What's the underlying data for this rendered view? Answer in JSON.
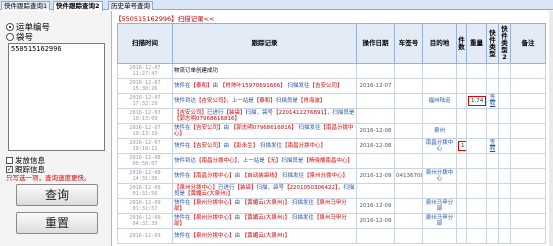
{
  "tabs": [
    {
      "label": "快件跟踪查询1"
    },
    {
      "label": "快件跟踪查询2"
    },
    {
      "label": "历史单号查询"
    }
  ],
  "left": {
    "radio_waybill": "运单编号",
    "radio_bag": "袋号",
    "waybill_value": "550515162996",
    "chk_issue": "发放信息",
    "chk_trace": "跟踪信息",
    "hint": "只写选一项，查询速度更快。",
    "query_button": "查询",
    "reset_button": "重置"
  },
  "right": {
    "record_header": "【550515162996】扫描记录<<"
  },
  "table": {
    "headers": [
      "扫描时间",
      "跟踪记录",
      "操作日期",
      "车签号",
      "目的地",
      "件数",
      "重量",
      "快件类型",
      "快件类型2",
      "备注"
    ],
    "rows": [
      {
        "time": "2016-12-07 11:27:47",
        "trace": [
          {
            "t": "物流订单创建成功",
            "c": "blk"
          }
        ],
        "date": "",
        "car": "",
        "dest": "",
        "qty": "",
        "weight": "",
        "type": "",
        "type2": ""
      },
      {
        "time": "2016-12-07 15:38:26",
        "trace": [
          {
            "t": "快件在",
            "c": "r"
          },
          {
            "t": "【泰和】",
            "c": "red"
          },
          {
            "t": "由 ",
            "c": "r"
          },
          {
            "t": "【肖帅叶15970691666】",
            "c": "red"
          },
          {
            "t": " 扫描发往",
            "c": "r"
          },
          {
            "t": "【吉安公司】",
            "c": "red"
          }
        ],
        "date": "2016-12-07",
        "car": "",
        "dest": "",
        "qty": "",
        "weight": "",
        "type": "",
        "type2": ""
      },
      {
        "time": "2016-12-07 17:32:20",
        "trace": [
          {
            "t": "快件到达",
            "c": "r"
          },
          {
            "t": "【吉安公司】",
            "c": "red"
          },
          {
            "t": "，上一站是",
            "c": "r"
          },
          {
            "t": "【泰和】",
            "c": "red"
          },
          {
            "t": "扫描员是",
            "c": "r"
          },
          {
            "t": "【肖海波】",
            "c": "red"
          }
        ],
        "date": "",
        "car": "",
        "dest": "福州陆运",
        "qty": "",
        "weight": "1.74",
        "type": "签收",
        "type2": ""
      },
      {
        "time": "2016-12-07 19:13:09",
        "trace": [
          {
            "t": "【吉安公司】",
            "c": "red"
          },
          {
            "t": "已进行",
            "c": "r"
          },
          {
            "t": "【装袋】",
            "c": "red"
          },
          {
            "t": "扫描，袋号",
            "c": "r"
          },
          {
            "t": "【2201412276891】",
            "c": "red"
          },
          {
            "t": "，扫描员是",
            "c": "r"
          },
          {
            "t": "【郭志明07968616816】",
            "c": "red"
          }
        ],
        "date": "",
        "car": "",
        "dest": "",
        "qty": "",
        "weight": "",
        "type": "",
        "type2": ""
      },
      {
        "time": "2016-12-07 19:13:19",
        "trace": [
          {
            "t": "快件在",
            "c": "r"
          },
          {
            "t": "【吉安公司】",
            "c": "red"
          },
          {
            "t": "由 ",
            "c": "r"
          },
          {
            "t": "【郭志明07968616816】",
            "c": "red"
          },
          {
            "t": " 扫描发往",
            "c": "r"
          },
          {
            "t": "【南昌分拨中心】",
            "c": "red"
          }
        ],
        "date": "2016-12-08",
        "car": "",
        "dest": "泉州",
        "qty": "",
        "weight": "",
        "type": "",
        "type2": ""
      },
      {
        "time": "2016-12-07 19:18:11",
        "trace": [
          {
            "t": "快件在",
            "c": "r"
          },
          {
            "t": "【吉安公司】",
            "c": "red"
          },
          {
            "t": "由 ",
            "c": "r"
          },
          {
            "t": "【彭永生】",
            "c": "red"
          },
          {
            "t": " 扫描发往",
            "c": "r"
          },
          {
            "t": "【南昌分拨中心】",
            "c": "red"
          }
        ],
        "date": "2016-12-08",
        "car": "",
        "dest": "南昌分拨中心",
        "qty": "1",
        "weight": "",
        "type": "签收",
        "type2": ""
      },
      {
        "time": "2016-12-08 00:50:07",
        "trace": [
          {
            "t": "快件到达",
            "c": "r"
          },
          {
            "t": "【南昌分拨中心】",
            "c": "red"
          },
          {
            "t": "，上一站是",
            "c": "r"
          },
          {
            "t": "【无】",
            "c": "red"
          },
          {
            "t": "扫描员是",
            "c": "r"
          },
          {
            "t": "【杨晓楼南昌中心】",
            "c": "red"
          }
        ],
        "date": "",
        "car": "",
        "dest": "",
        "qty": "",
        "weight": "",
        "type": "",
        "type2": ""
      },
      {
        "time": "2016-12-08 14:31:36",
        "trace": [
          {
            "t": "快件在",
            "c": "r"
          },
          {
            "t": "【南昌分拨中心】",
            "c": "red"
          },
          {
            "t": "由 ",
            "c": "r"
          },
          {
            "t": "【自动装袋线】",
            "c": "red"
          },
          {
            "t": " 扫描发往",
            "c": "r"
          },
          {
            "t": "【泉州分拨中心】",
            "c": "red"
          }
        ],
        "date": "2016-12-09",
        "car": "04136700",
        "dest": "泉州分拨中心",
        "qty": "",
        "weight": "",
        "type": "",
        "type2": ""
      },
      {
        "time": "2016-12-09 01:31:56",
        "trace": [
          {
            "t": "【泉州分拨中心】",
            "c": "red"
          },
          {
            "t": "已进行",
            "c": "r"
          },
          {
            "t": "【装袋】",
            "c": "red"
          },
          {
            "t": "扫描，袋号",
            "c": "r"
          },
          {
            "t": "【2201050306422】",
            "c": "red"
          },
          {
            "t": "，扫描员是",
            "c": "r"
          },
          {
            "t": "【黄媚云(大泉州)】",
            "c": "red"
          }
        ],
        "date": "",
        "car": "",
        "dest": "",
        "qty": "",
        "weight": "",
        "type": "",
        "type2": ""
      },
      {
        "time": "2016-12-09 01:31:57",
        "trace": [
          {
            "t": "快件在",
            "c": "r"
          },
          {
            "t": "【泉州分拨中心】",
            "c": "red"
          },
          {
            "t": "由 ",
            "c": "r"
          },
          {
            "t": "【黄媚云(大泉州)】",
            "c": "red"
          },
          {
            "t": " 扫描发往",
            "c": "r"
          },
          {
            "t": "【泉州马甲分部】",
            "c": "red"
          }
        ],
        "date": "2016-12-09",
        "car": "",
        "dest": "泉州马甲分部",
        "qty": "",
        "weight": "",
        "type": "",
        "type2": ""
      },
      {
        "time": "2016-12-09 04:31:39",
        "trace": [
          {
            "t": "快件在",
            "c": "r"
          },
          {
            "t": "【泉州分拨中心】",
            "c": "red"
          },
          {
            "t": "由 ",
            "c": "r"
          },
          {
            "t": "【黄媚云(大泉州)】",
            "c": "red"
          },
          {
            "t": " 扫描发往",
            "c": "r"
          },
          {
            "t": "【泉州马甲分部】",
            "c": "red"
          }
        ],
        "date": "2016-12-09",
        "car": "",
        "dest": "泉州马甲分部",
        "qty": "",
        "weight": "",
        "type": "",
        "type2": ""
      },
      {
        "time": "2016-12-09",
        "trace": [
          {
            "t": "快件在",
            "c": "r"
          },
          {
            "t": "【泉州分拨中心】",
            "c": "red"
          },
          {
            "t": "由 ",
            "c": "r"
          },
          {
            "t": "【黄媚云(大泉州)】",
            "c": "red"
          }
        ],
        "date": "",
        "car": "",
        "dest": "",
        "qty": "",
        "weight": "",
        "type": "",
        "type2": ""
      }
    ]
  },
  "colors": {
    "accent_red": "#d40000",
    "link_blue": "#2a52a8",
    "header_bg": "#e3ebf7"
  }
}
